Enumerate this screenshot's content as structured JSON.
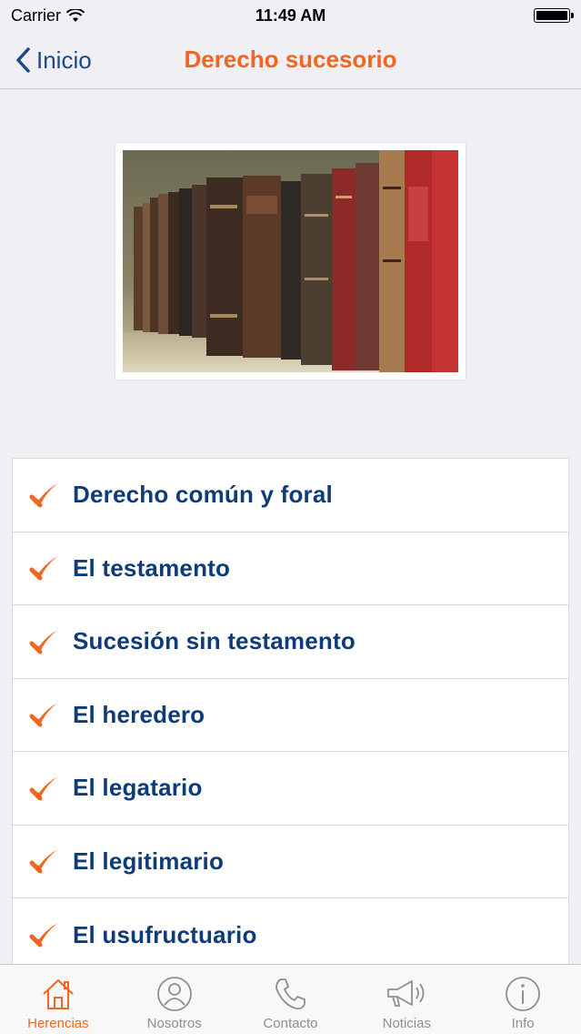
{
  "status": {
    "carrier": "Carrier",
    "time": "11:49 AM",
    "battery_level": 1.0
  },
  "nav": {
    "back_label": "Inicio",
    "title": "Derecho sucesorio"
  },
  "hero": {
    "image_icon": "books-on-shelf-photo"
  },
  "list": {
    "items": [
      {
        "label": "Derecho común y foral"
      },
      {
        "label": "El testamento"
      },
      {
        "label": "Sucesión sin testamento"
      },
      {
        "label": "El heredero"
      },
      {
        "label": "El legatario"
      },
      {
        "label": "El legitimario"
      },
      {
        "label": "El usufructuario"
      }
    ],
    "check_icon": "checkmark-icon",
    "check_color": "#f26522"
  },
  "tabs": [
    {
      "label": "Herencias",
      "icon": "house-icon",
      "active": true
    },
    {
      "label": "Nosotros",
      "icon": "person-icon",
      "active": false
    },
    {
      "label": "Contacto",
      "icon": "phone-icon",
      "active": false
    },
    {
      "label": "Noticias",
      "icon": "megaphone-icon",
      "active": false
    },
    {
      "label": "Info",
      "icon": "info-icon",
      "active": false
    }
  ],
  "colors": {
    "accent": "#f26522",
    "text_primary": "#0f3c78",
    "back_blue": "#1a4a8a",
    "tab_inactive": "#8e8e93"
  }
}
